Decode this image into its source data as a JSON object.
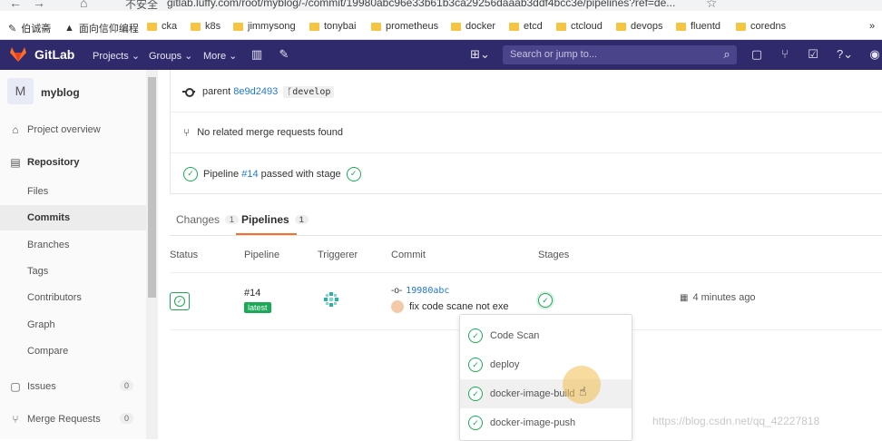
{
  "browser": {
    "insecure_label": "不安全",
    "url": "gitlab.luffy.com/root/myblog/-/commit/19980abc96e33b61b3ca29256daaab3ddf4bcc3e/pipelines?ref=de...",
    "bookmarks": [
      "伯诚斋",
      "面向信仰编程",
      "cka",
      "k8s",
      "jimmysong",
      "tonybai",
      "prometheus",
      "docker",
      "etcd",
      "ctcloud",
      "devops",
      "fluentd",
      "coredns"
    ],
    "more": "»"
  },
  "nav": {
    "brand": "GitLab",
    "projects": "Projects",
    "groups": "Groups",
    "more": "More",
    "search_placeholder": "Search or jump to..."
  },
  "sidebar": {
    "project_initial": "M",
    "project_name": "myblog",
    "items": [
      {
        "label": "Project overview"
      },
      {
        "label": "Repository"
      },
      {
        "label": "Files"
      },
      {
        "label": "Commits"
      },
      {
        "label": "Branches"
      },
      {
        "label": "Tags"
      },
      {
        "label": "Contributors"
      },
      {
        "label": "Graph"
      },
      {
        "label": "Compare"
      },
      {
        "label": "Issues",
        "count": "0"
      },
      {
        "label": "Merge Requests",
        "count": "0"
      }
    ]
  },
  "commit_info": {
    "parent_label": "parent",
    "parent_sha": "8e9d2493",
    "branch": "develop",
    "merge_text": "No related merge requests found",
    "pipeline_prefix": "Pipeline",
    "pipeline_id": "#14",
    "pipeline_suffix": "passed with stage"
  },
  "tabs": [
    {
      "label": "Changes",
      "count": "1"
    },
    {
      "label": "Pipelines",
      "count": "1"
    }
  ],
  "table": {
    "headers": [
      "Status",
      "Pipeline",
      "Triggerer",
      "Commit",
      "Stages"
    ],
    "row": {
      "pipeline_id": "#14",
      "tag": "latest",
      "commit_sha": "19980abc",
      "commit_msg": "fix code scane not exe",
      "time": "4 minutes ago"
    }
  },
  "stages_dropdown": [
    "Code Scan",
    "deploy",
    "docker-image-build",
    "docker-image-push"
  ],
  "watermark": "https://blog.csdn.net/qq_42227818",
  "colors": {
    "success": "#1aaa55",
    "nav": "#2f2a6b",
    "link": "#1f78d1",
    "accent": "#fc6d26"
  }
}
